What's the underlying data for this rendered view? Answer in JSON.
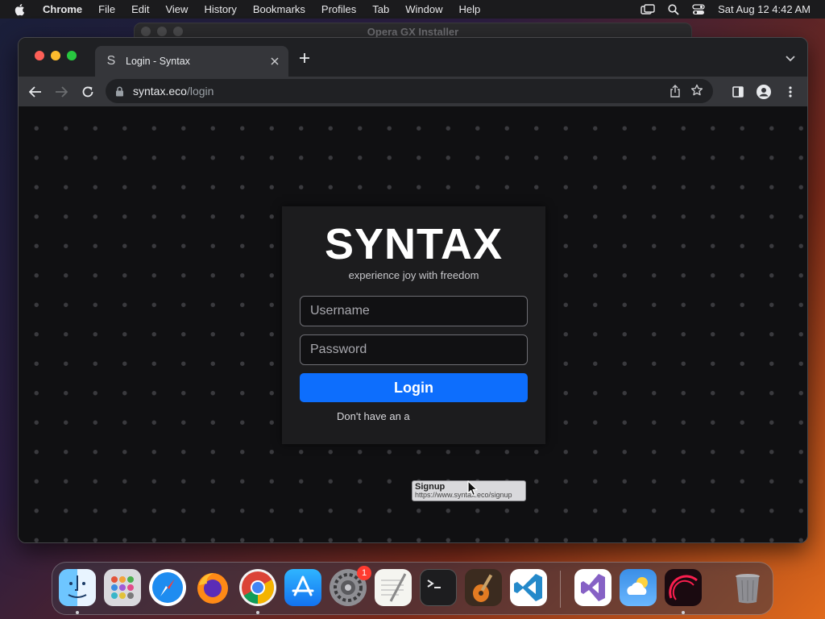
{
  "menubar": {
    "app": "Chrome",
    "menus": [
      "File",
      "Edit",
      "View",
      "History",
      "Bookmarks",
      "Profiles",
      "Tab",
      "Window",
      "Help"
    ],
    "clock": "Sat Aug 12  4:42 AM"
  },
  "background_window": {
    "title": "Opera GX Installer"
  },
  "browser": {
    "tab_title": "Login - Syntax",
    "favicon": "S",
    "url_host": "syntax.eco",
    "url_path": "/login"
  },
  "login": {
    "brand": "SYNTAX",
    "tagline": "experience joy with freedom",
    "username_placeholder": "Username",
    "password_placeholder": "Password",
    "login_label": "Login",
    "signup_prompt": "Don't have an a"
  },
  "tooltip": {
    "title": "Signup",
    "url": "https://www.syntax.eco/signup"
  },
  "dock": {
    "notification_count": "1",
    "apps": [
      "finder-icon",
      "launchpad-icon",
      "safari-icon",
      "firefox-icon",
      "chrome-icon",
      "app-store-icon",
      "system-settings-icon",
      "textedit-icon",
      "terminal-icon",
      "garageband-icon",
      "vscode-icon",
      "visual-studio-icon",
      "weather-icon",
      "opera-gx-icon",
      "trash-icon"
    ]
  }
}
